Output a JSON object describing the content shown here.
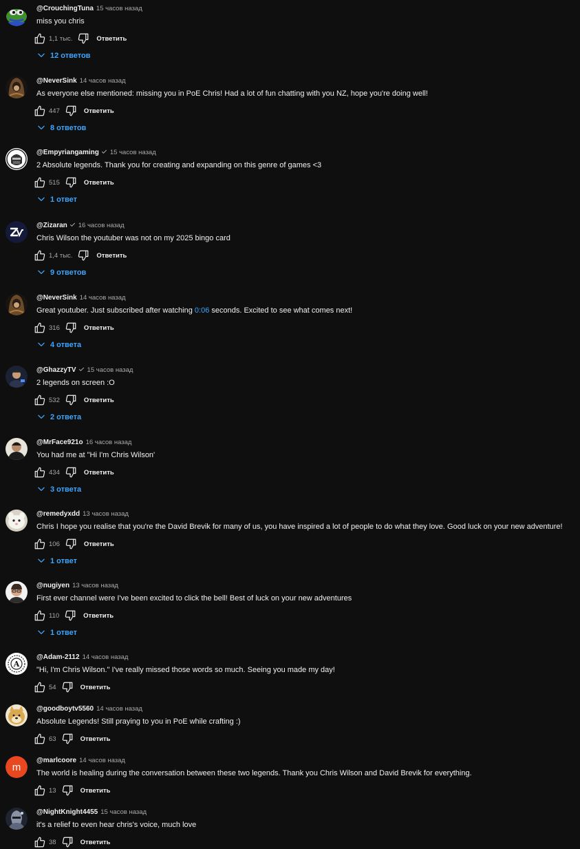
{
  "colors": {
    "background": "#0f0f0f",
    "text": "#f1f1f1",
    "muted": "#aaaaaa",
    "link": "#3ea6ff"
  },
  "comments": [
    {
      "author": "@CrouchingTuna",
      "time": "15 часов назад",
      "text": "miss you chris",
      "likes": "1,1 тыс.",
      "reply_label": "Ответить",
      "replies": "12 ответов",
      "avatar_icon": "pepe-frog-avatar",
      "verified": false
    },
    {
      "author": "@NeverSink",
      "time": "14 часов назад",
      "text": "As everyone else mentioned: missing you in PoE Chris! Had a lot of fun chatting with you NZ, hope you're doing well!",
      "likes": "447",
      "reply_label": "Ответить",
      "replies": "8 ответов",
      "avatar_icon": "hooded-figure-avatar",
      "verified": false
    },
    {
      "author": "@Empyriangaming",
      "time": "15 часов назад",
      "text": "2 Absolute legends. Thank you for creating and expanding on this genre of games <3",
      "likes": "515",
      "reply_label": "Ответить",
      "replies": "1 ответ",
      "avatar_icon": "skull-helmet-avatar",
      "verified": true
    },
    {
      "author": "@Zizaran",
      "time": "16 часов назад",
      "text": "Chris Wilson the youtuber was not on my 2025 bingo card",
      "likes": "1,4 тыс.",
      "reply_label": "Ответить",
      "replies": "9 ответов",
      "avatar_icon": "zizaran-logo-avatar",
      "verified": true
    },
    {
      "author": "@NeverSink",
      "time": "14 часов назад",
      "text_before": "Great youtuber. Just subscribed after watching ",
      "timestamp": "0:06",
      "text_after": " seconds. Excited to see what comes next!",
      "likes": "316",
      "reply_label": "Ответить",
      "replies": "4 ответа",
      "avatar_icon": "hooded-figure-avatar",
      "verified": false
    },
    {
      "author": "@GhazzyTV",
      "time": "15 часов назад",
      "text": "2 legends on screen :O",
      "likes": "532",
      "reply_label": "Ответить",
      "replies": "2 ответа",
      "avatar_icon": "person-photo-avatar",
      "verified": true
    },
    {
      "author": "@MrFace921o",
      "time": "16 часов назад",
      "text": "You had me at \"Hi I'm Chris Wilson'",
      "likes": "434",
      "reply_label": "Ответить",
      "replies": "3 ответа",
      "avatar_icon": "portrait-avatar",
      "verified": false
    },
    {
      "author": "@remedyxdd",
      "time": "13 часов назад",
      "text": "Chris I hope you realise that you're the David Brevik for many of us, you have inspired a lot of people to do what they love. Good luck on your new adventure!",
      "likes": "106",
      "reply_label": "Ответить",
      "replies": "1 ответ",
      "avatar_icon": "white-animal-avatar",
      "verified": false
    },
    {
      "author": "@nugiyen",
      "time": "13 часов назад",
      "text": "First ever channel were I've been excited to click the bell! Best of luck on your new adventures",
      "likes": "110",
      "reply_label": "Ответить",
      "replies": "1 ответ",
      "avatar_icon": "glasses-person-avatar",
      "verified": false
    },
    {
      "author": "@Adam-2112",
      "time": "14 часов назад",
      "text": "\"Hi, I'm Chris Wilson.\" I've really missed those words so much. Seeing you made my day!",
      "likes": "54",
      "reply_label": "Ответить",
      "avatar_icon": "letter-a-emblem-avatar",
      "avatar_letter": "A",
      "verified": false
    },
    {
      "author": "@goodboytv5560",
      "time": "14 часов назад",
      "text": "Absolute Legends! Still praying to you in PoE while crafting :)",
      "likes": "63",
      "reply_label": "Ответить",
      "avatar_icon": "doge-avatar",
      "verified": false
    },
    {
      "author": "@marlcoore",
      "time": "14 часов назад",
      "text": "The world is healing during the conversation between these two legends. Thank you Chris Wilson and David Brevik for everything.",
      "likes": "13",
      "reply_label": "Ответить",
      "avatar_icon": "letter-m-avatar",
      "avatar_letter": "m",
      "avatar_color": "#e8471f",
      "verified": false
    },
    {
      "author": "@NightKnight4455",
      "time": "15 часов назад",
      "text": "it's a relief to even hear chris's voice, much love",
      "likes": "38",
      "reply_label": "Ответить",
      "avatar_icon": "armored-knight-avatar",
      "verified": false
    }
  ]
}
